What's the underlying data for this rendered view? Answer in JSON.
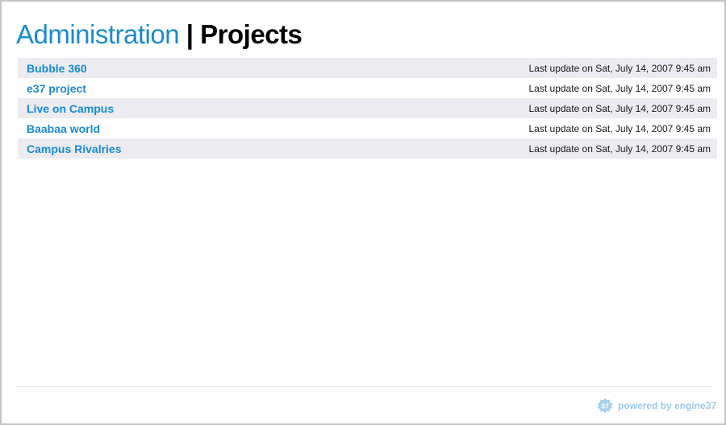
{
  "header": {
    "section": "Administration",
    "separator": "|",
    "page": "Projects"
  },
  "projects": [
    {
      "name": "Bubble 360",
      "updated": "Last update on Sat, July 14, 2007 9:45 am"
    },
    {
      "name": "e37 project",
      "updated": "Last update on Sat, July 14, 2007 9:45 am"
    },
    {
      "name": "Live on Campus",
      "updated": "Last update on Sat, July 14, 2007 9:45 am"
    },
    {
      "name": "Baabaa world",
      "updated": "Last update on Sat, July 14, 2007 9:45 am"
    },
    {
      "name": "Campus Rivalries",
      "updated": "Last update on Sat, July 14, 2007 9:45 am"
    }
  ],
  "footer": {
    "badge_text": "37",
    "powered_text": "powered by engine37",
    "badge_icon": "engine37-badge-icon"
  },
  "colors": {
    "accent": "#1a8ad4",
    "row_alt": "#ebebf0",
    "footer_text": "#9cc8ea"
  }
}
